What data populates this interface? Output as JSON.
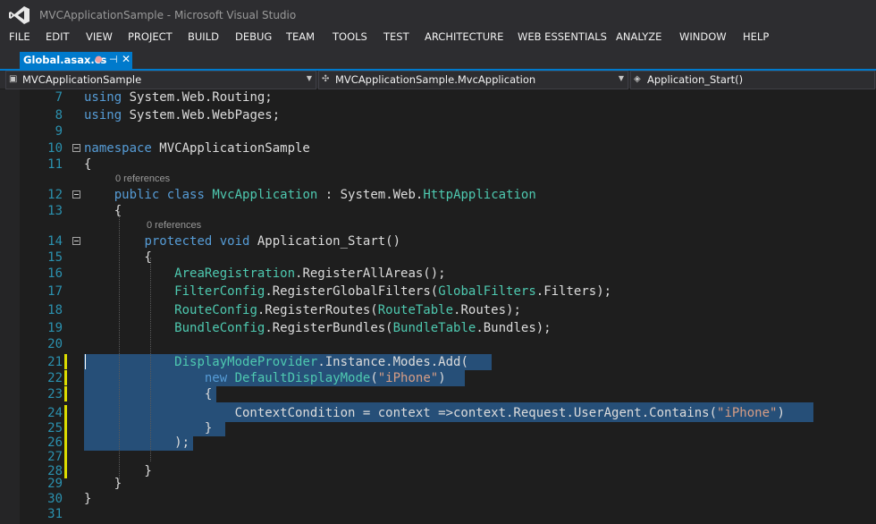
{
  "window": {
    "title": "MVCApplicationSample - Microsoft Visual Studio",
    "logo_icon": "visual-studio-logo-icon"
  },
  "menu": {
    "items": [
      "FILE",
      "EDIT",
      "VIEW",
      "PROJECT",
      "BUILD",
      "DEBUG",
      "TEAM",
      "TOOLS",
      "TEST",
      "ARCHITECTURE",
      "WEB ESSENTIALS",
      "ANALYZE",
      "WINDOW",
      "HELP"
    ]
  },
  "tab": {
    "label": "Global.asax.cs",
    "modified_dot": "●",
    "pin_glyph": "⊣",
    "close_glyph": "✕"
  },
  "navbar": {
    "project": "MVCApplicationSample",
    "type": "MVCApplicationSample.MvcApplication",
    "member": "Application_Start()"
  },
  "code_lines": [
    {
      "num": "7",
      "tokens": [
        {
          "t": "using",
          "c": "kw"
        },
        {
          "t": " System.Web.Routing;"
        }
      ]
    },
    {
      "num": "8",
      "tokens": [
        {
          "t": "using",
          "c": "kw"
        },
        {
          "t": " System.Web.WebPages;"
        }
      ]
    },
    {
      "num": "9",
      "tokens": []
    },
    {
      "num": "10",
      "fold": true,
      "tokens": [
        {
          "t": "namespace",
          "c": "kw"
        },
        {
          "t": " MVCApplicationSample"
        }
      ]
    },
    {
      "num": "11",
      "tokens": [
        {
          "t": "{"
        }
      ]
    },
    {
      "num": "12",
      "fold": true,
      "ref": "0 references",
      "tokens": [
        {
          "t": "    "
        },
        {
          "t": "public",
          "c": "kw"
        },
        {
          "t": " "
        },
        {
          "t": "class",
          "c": "kw"
        },
        {
          "t": " "
        },
        {
          "t": "MvcApplication",
          "c": "ty"
        },
        {
          "t": " : System.Web."
        },
        {
          "t": "HttpApplication",
          "c": "ty"
        }
      ]
    },
    {
      "num": "13",
      "tokens": [
        {
          "t": "    {"
        }
      ]
    },
    {
      "num": "14",
      "fold": true,
      "ref": "0 references",
      "tokens": [
        {
          "t": "        "
        },
        {
          "t": "protected",
          "c": "kw"
        },
        {
          "t": " "
        },
        {
          "t": "void",
          "c": "kw"
        },
        {
          "t": " Application_Start()"
        }
      ]
    },
    {
      "num": "15",
      "tokens": [
        {
          "t": "        {"
        }
      ]
    },
    {
      "num": "16",
      "tokens": [
        {
          "t": "            "
        },
        {
          "t": "AreaRegistration",
          "c": "ty"
        },
        {
          "t": ".RegisterAllAreas();"
        }
      ]
    },
    {
      "num": "17",
      "tokens": [
        {
          "t": "            "
        },
        {
          "t": "FilterConfig",
          "c": "ty"
        },
        {
          "t": ".RegisterGlobalFilters("
        },
        {
          "t": "GlobalFilters",
          "c": "ty"
        },
        {
          "t": ".Filters);"
        }
      ]
    },
    {
      "num": "18",
      "tokens": [
        {
          "t": "            "
        },
        {
          "t": "RouteConfig",
          "c": "ty"
        },
        {
          "t": ".RegisterRoutes("
        },
        {
          "t": "RouteTable",
          "c": "ty"
        },
        {
          "t": ".Routes);"
        }
      ]
    },
    {
      "num": "19",
      "tokens": [
        {
          "t": "            "
        },
        {
          "t": "BundleConfig",
          "c": "ty"
        },
        {
          "t": ".RegisterBundles("
        },
        {
          "t": "BundleTable",
          "c": "ty"
        },
        {
          "t": ".Bundles);"
        }
      ]
    },
    {
      "num": "20",
      "tokens": []
    },
    {
      "num": "21",
      "changed": true,
      "tokens": [
        {
          "t": "            "
        },
        {
          "t": "DisplayModeProvider",
          "c": "ty"
        },
        {
          "t": ".Instance.Modes.Add("
        }
      ]
    },
    {
      "num": "22",
      "changed": true,
      "tokens": [
        {
          "t": "                "
        },
        {
          "t": "new",
          "c": "kw"
        },
        {
          "t": " "
        },
        {
          "t": "DefaultDisplayMode",
          "c": "ty"
        },
        {
          "t": "("
        },
        {
          "t": "\"iPhone\"",
          "c": "str"
        },
        {
          "t": ")"
        }
      ]
    },
    {
      "num": "23",
      "changed": true,
      "tokens": [
        {
          "t": "                {"
        }
      ]
    },
    {
      "num": "24",
      "changed": true,
      "tokens": [
        {
          "t": "                    ContextCondition = context =>context.Request.UserAgent.Contains("
        },
        {
          "t": "\"iPhone\"",
          "c": "str"
        },
        {
          "t": ")"
        }
      ]
    },
    {
      "num": "25",
      "changed": true,
      "tokens": [
        {
          "t": "                }"
        }
      ]
    },
    {
      "num": "26",
      "changed": true,
      "tokens": [
        {
          "t": "            );"
        }
      ]
    },
    {
      "num": "27",
      "changed": true,
      "tokens": []
    },
    {
      "num": "28",
      "changed": true,
      "tokens": [
        {
          "t": "        }"
        }
      ]
    },
    {
      "num": "29",
      "tokens": [
        {
          "t": "    }"
        }
      ]
    },
    {
      "num": "30",
      "tokens": [
        {
          "t": "}"
        }
      ]
    },
    {
      "num": "31",
      "tokens": []
    }
  ]
}
